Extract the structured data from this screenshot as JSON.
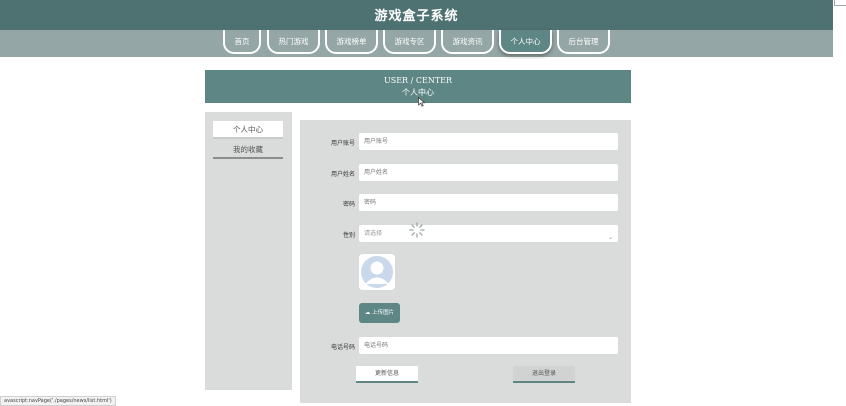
{
  "site": {
    "title": "游戏盒子系统"
  },
  "nav": {
    "items": [
      {
        "label": "首页"
      },
      {
        "label": "热门游戏"
      },
      {
        "label": "游戏榜单"
      },
      {
        "label": "游戏专区"
      },
      {
        "label": "游戏资讯"
      },
      {
        "label": "个人中心",
        "active": true
      },
      {
        "label": "后台管理"
      }
    ]
  },
  "header": {
    "title_en": "USER / CENTER",
    "title_cn": "个人中心"
  },
  "sidebar": {
    "items": [
      {
        "label": "个人中心",
        "active": true
      },
      {
        "label": "我的收藏"
      }
    ]
  },
  "form": {
    "account": {
      "label": "用户账号",
      "placeholder": "用户账号"
    },
    "name": {
      "label": "用户姓名",
      "placeholder": "用户姓名"
    },
    "password": {
      "label": "密码",
      "placeholder": "密码"
    },
    "gender": {
      "label": "性别",
      "placeholder": "请选择"
    },
    "upload_label": "上传图片",
    "phone": {
      "label": "电话号码",
      "placeholder": "电话号码"
    },
    "update_label": "更新信息",
    "logout_label": "退出登录"
  },
  "status_bar": {
    "url": "avascript:navPage('./pages/news/list.html')"
  },
  "colors": {
    "primary": "#5e8684",
    "topbar": "#4e7271",
    "navbar": "#94a6a5",
    "panel": "#d9dcdb"
  }
}
